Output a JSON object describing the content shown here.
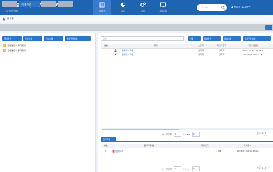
{
  "brand": {
    "name_part1": "Smart",
    "name_part2": "Archiver",
    "subtitle": "스마트아카이버"
  },
  "nav": [
    {
      "label": "문서함",
      "icon": "document-box-icon"
    },
    {
      "label": "통계",
      "icon": "pie-chart-icon"
    },
    {
      "label": "관리",
      "icon": "gear-icon"
    },
    {
      "label": "서버관리",
      "icon": "monitor-icon"
    }
  ],
  "search": {
    "placeholder": "Search"
  },
  "user": {
    "text": "▲ 관리자 로그아웃"
  },
  "breadcrumb": {
    "text": "문서함"
  },
  "tabs": [
    {
      "label": ""
    },
    {
      "label": "개인문서함"
    },
    {
      "label": ""
    },
    {
      "label": ""
    }
  ],
  "left_toolbar": [
    {
      "label": "폴더추가"
    },
    {
      "label": "폴더수정"
    },
    {
      "label": "폴더삭제"
    },
    {
      "label": "폴더권한설정"
    }
  ],
  "tree": [
    {
      "label": "글로벌문서 폴더위치"
    },
    {
      "label": "글로벌문서 폴더위치"
    }
  ],
  "filter": {
    "placeholder": "검색"
  },
  "right_toolbar": [
    {
      "label": "검색"
    },
    {
      "label": "문서추가"
    },
    {
      "label": "문서삭제"
    },
    {
      "label": "문서권한설정"
    }
  ],
  "grid": {
    "headers": [
      "번호",
      "",
      "제목",
      "소유자",
      "최종수정자",
      "최종수정일"
    ],
    "rows": [
      [
        "1",
        "folder",
        "샘플문서 파일",
        "관리자",
        "관리자",
        "2016-07-06 15:17:5"
      ],
      [
        "2",
        "file",
        "샘플문서 파일",
        "관리자",
        "관리자",
        "2016-07-06 15:15"
      ]
    ]
  },
  "pager_top": {
    "text1": "페이지",
    "page": "1",
    "text2": "/ 1",
    "count": "보기 1 - 2"
  },
  "subtab": {
    "label": "첨부파일"
  },
  "grid2": {
    "headers": [
      "번호",
      "첨부파일명",
      "파일크기",
      "등록일시"
    ],
    "rows": [
      [
        "1",
        "샘플.pdf",
        "2 KB",
        "2016-07-06 15:15:26"
      ]
    ]
  },
  "pager_bottom": {
    "text1": "페이지",
    "page": "1",
    "text2": "/ 1",
    "count": "보기 1 - 1"
  },
  "colors": {
    "header": "#1f63b3",
    "accent": "#2f74c8",
    "brand_accent": "#f5a623"
  }
}
